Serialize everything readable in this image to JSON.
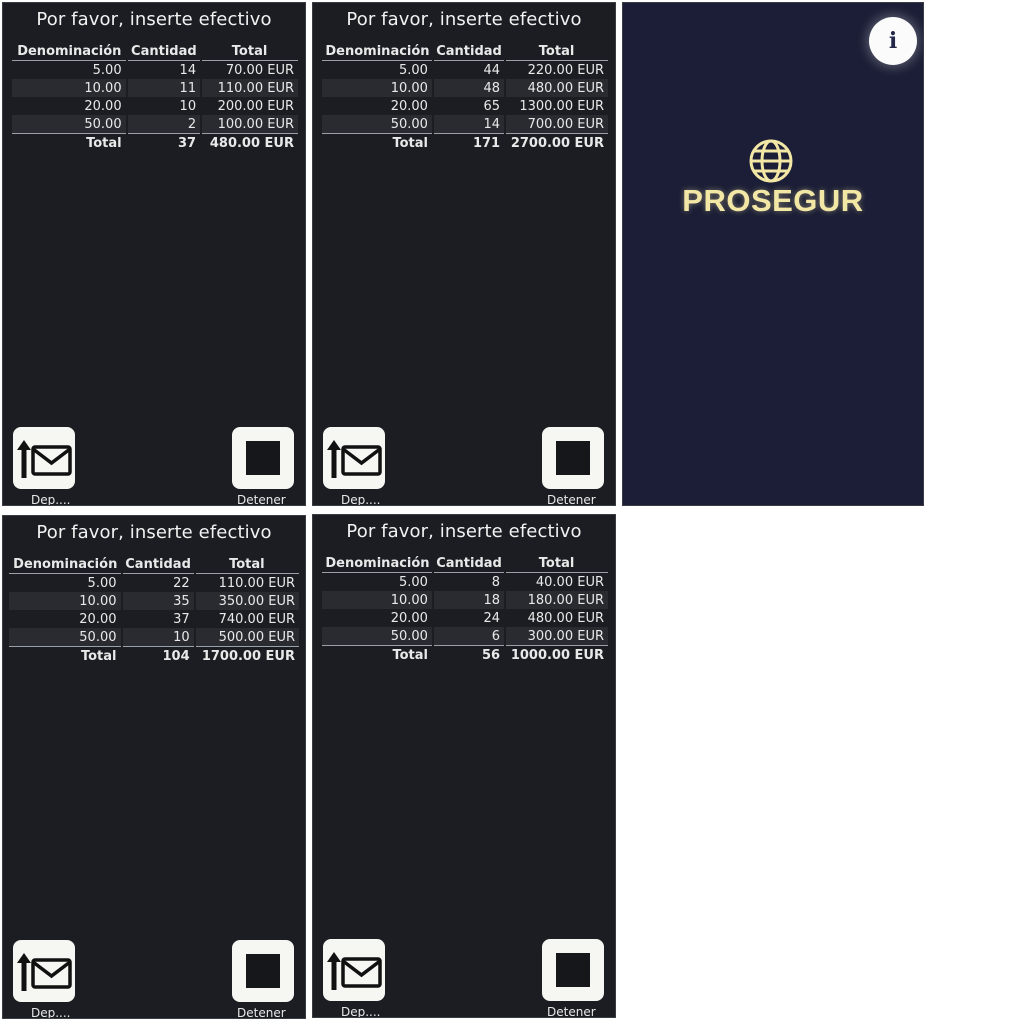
{
  "panels": [
    {
      "title": "Por favor, inserte efectivo",
      "headers": [
        "Denominación",
        "Cantidad",
        "Total"
      ],
      "rows": [
        {
          "denom": "5.00",
          "qty": "14",
          "total": "70.00 EUR"
        },
        {
          "denom": "10.00",
          "qty": "11",
          "total": "110.00 EUR"
        },
        {
          "denom": "20.00",
          "qty": "10",
          "total": "200.00 EUR"
        },
        {
          "denom": "50.00",
          "qty": "2",
          "total": "100.00 EUR"
        }
      ],
      "total_row": {
        "label": "Total",
        "qty": "37",
        "total": "480.00 EUR"
      },
      "deposit_label": "Dep....",
      "stop_label": "Detener"
    },
    {
      "title": "Por favor, inserte efectivo",
      "headers": [
        "Denominación",
        "Cantidad",
        "Total"
      ],
      "rows": [
        {
          "denom": "5.00",
          "qty": "44",
          "total": "220.00 EUR"
        },
        {
          "denom": "10.00",
          "qty": "48",
          "total": "480.00 EUR"
        },
        {
          "denom": "20.00",
          "qty": "65",
          "total": "1300.00 EUR"
        },
        {
          "denom": "50.00",
          "qty": "14",
          "total": "700.00 EUR"
        }
      ],
      "total_row": {
        "label": "Total",
        "qty": "171",
        "total": "2700.00 EUR"
      },
      "deposit_label": "Dep....",
      "stop_label": "Detener"
    },
    {
      "title": "Por favor, inserte efectivo",
      "headers": [
        "Denominación",
        "Cantidad",
        "Total"
      ],
      "rows": [
        {
          "denom": "5.00",
          "qty": "22",
          "total": "110.00 EUR"
        },
        {
          "denom": "10.00",
          "qty": "35",
          "total": "350.00 EUR"
        },
        {
          "denom": "20.00",
          "qty": "37",
          "total": "740.00 EUR"
        },
        {
          "denom": "50.00",
          "qty": "10",
          "total": "500.00 EUR"
        }
      ],
      "total_row": {
        "label": "Total",
        "qty": "104",
        "total": "1700.00 EUR"
      },
      "deposit_label": "Dep....",
      "stop_label": "Detener"
    },
    {
      "title": "Por favor, inserte efectivo",
      "headers": [
        "Denominación",
        "Cantidad",
        "Total"
      ],
      "rows": [
        {
          "denom": "5.00",
          "qty": "8",
          "total": "40.00 EUR"
        },
        {
          "denom": "10.00",
          "qty": "18",
          "total": "180.00 EUR"
        },
        {
          "denom": "20.00",
          "qty": "24",
          "total": "480.00 EUR"
        },
        {
          "denom": "50.00",
          "qty": "6",
          "total": "300.00 EUR"
        }
      ],
      "total_row": {
        "label": "Total",
        "qty": "56",
        "total": "1000.00 EUR"
      },
      "deposit_label": "Dep....",
      "stop_label": "Detener"
    }
  ],
  "splash": {
    "brand": "PROSEGUR",
    "info_icon": "i",
    "brand_color": "#f3e7a6",
    "background_color": "#1b1e36"
  },
  "icons": {
    "deposit": "upload-envelope-icon",
    "stop": "stop-square-icon",
    "info": "info-icon",
    "logo": "globe-icon"
  },
  "colors": {
    "screen_background": "#1c1d22",
    "text": "#e9e9e9",
    "button_background": "#f6f7f2"
  }
}
